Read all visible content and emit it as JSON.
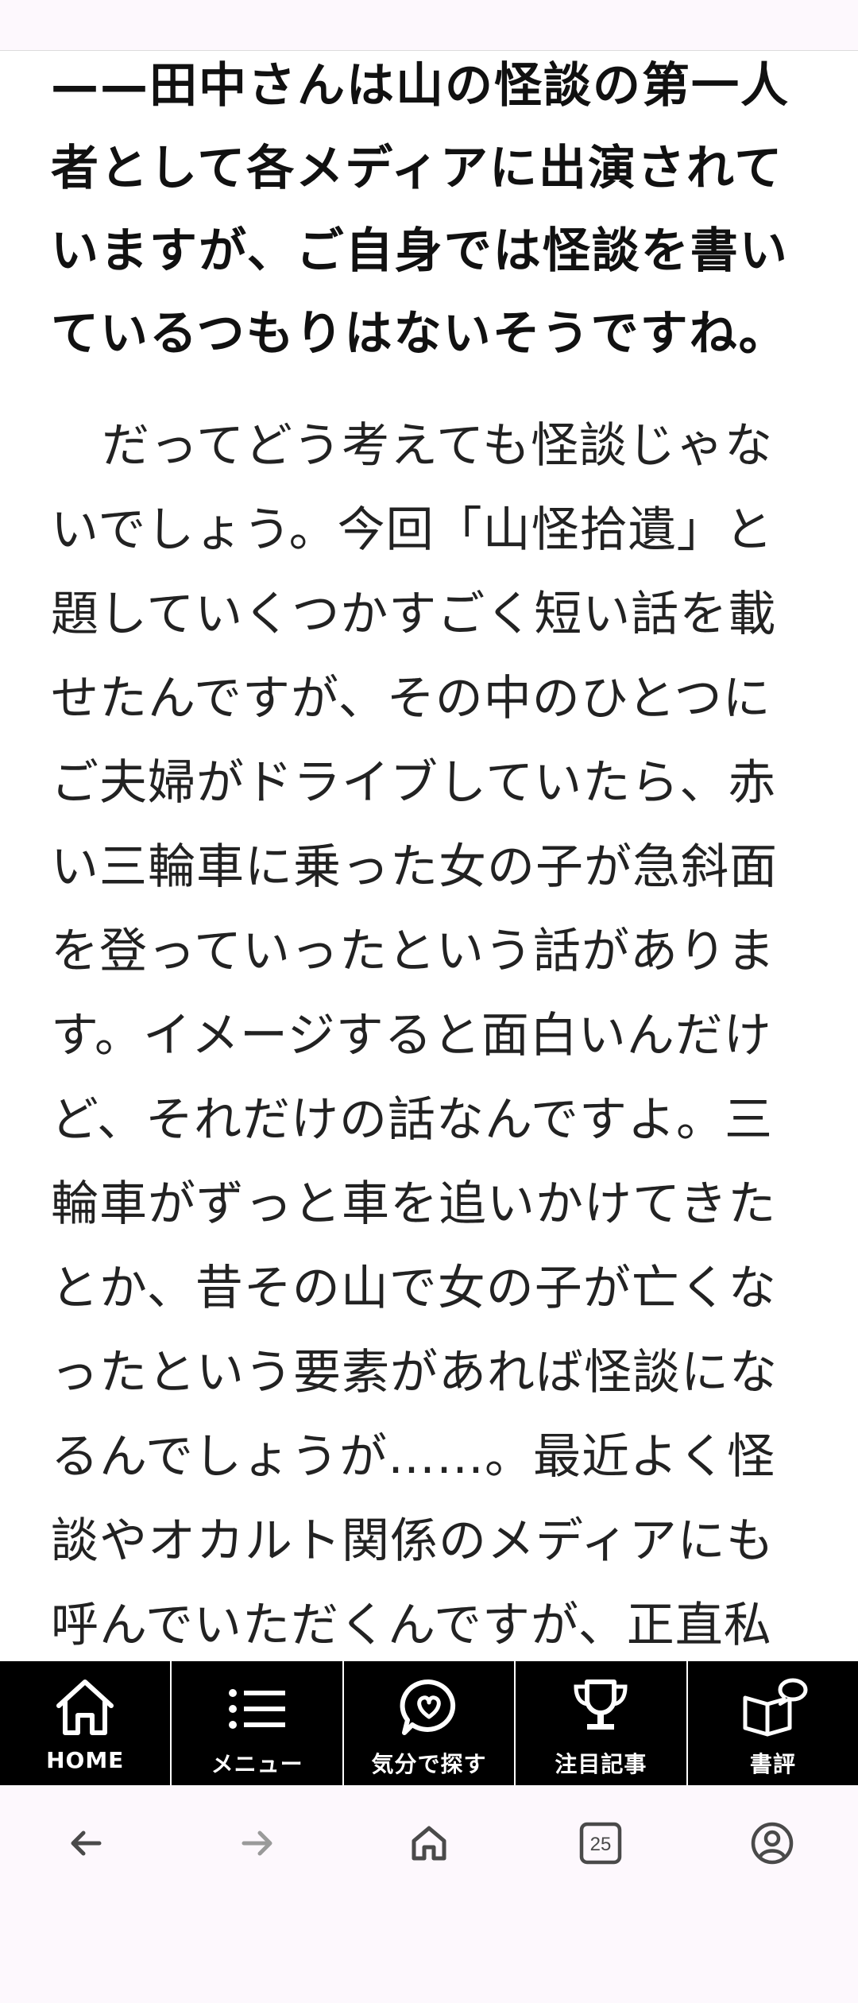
{
  "article": {
    "question": "——田中さんは山の怪談の第一人者として各メディアに出演されていますが、ご自身では怪談を書いているつもりはないそうですね。",
    "answer": "だってどう考えても怪談じゃないでしょう。今回「山怪拾遺」と題していくつかすごく短い話を載せたんですが、その中のひとつにご夫婦がドライブしていたら、赤い三輪車に乗った女の子が急斜面を登っていったという話があります。イメージすると面白いんだけど、それだけの話なんですよ。三輪車がずっと車を追いかけてきたとか、昔その山で女の子が亡くなったという要素があれば怪談になるんでしょうが……。最近よく怪談やオカルト関係のメディアにも呼んでいただくんですが、正直私"
  },
  "site_nav": {
    "items": [
      {
        "label": "HOME",
        "icon": "home-icon"
      },
      {
        "label": "メニュー",
        "icon": "menu-icon"
      },
      {
        "label": "気分で探す",
        "icon": "heart-bubble-icon"
      },
      {
        "label": "注目記事",
        "icon": "trophy-icon"
      },
      {
        "label": "書評",
        "icon": "book-bubble-icon"
      }
    ]
  },
  "browser_bar": {
    "tab_count": "25",
    "icons": [
      "back-arrow-icon",
      "forward-arrow-icon",
      "home-icon",
      "tabs-icon",
      "account-icon"
    ]
  },
  "colors": {
    "nav_background": "#000000",
    "nav_text": "#ffffff",
    "browser_background": "#fdf8fd",
    "browser_icon": "#4a4a4a",
    "browser_icon_disabled": "#9a9a9a"
  }
}
